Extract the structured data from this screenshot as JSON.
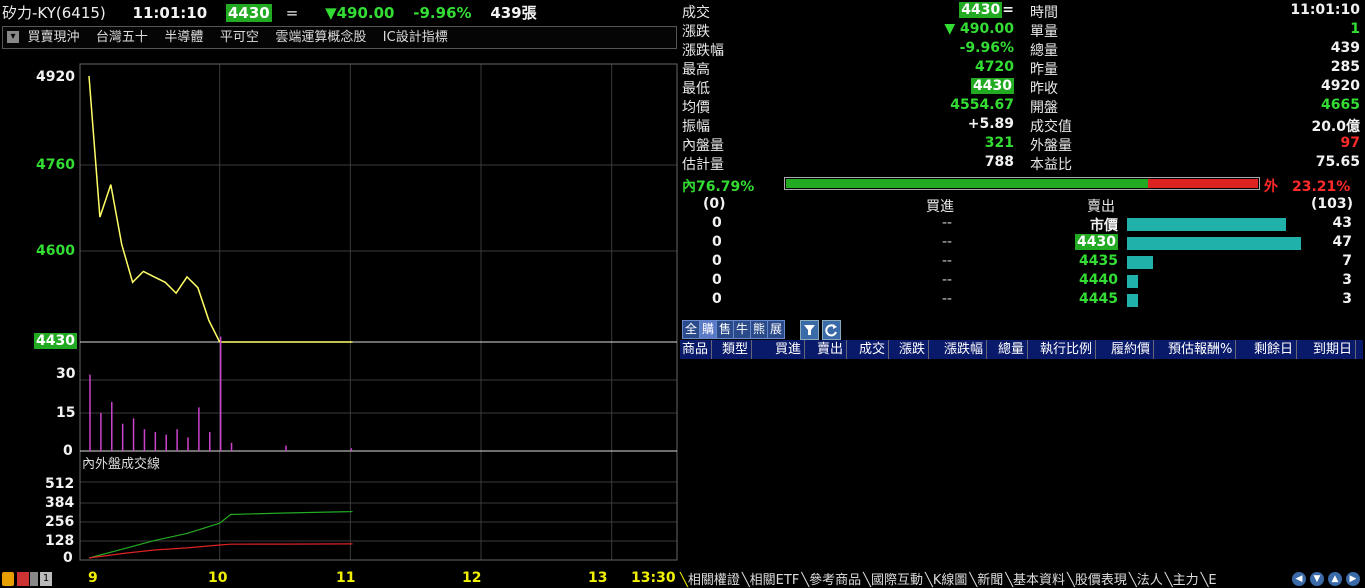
{
  "header": {
    "stock": "矽力-KY(6415)",
    "time": "11:01:10",
    "price": "4430",
    "price_suffix": "=",
    "change": "▼490.00",
    "change_pct": "-9.96%",
    "volume": "439張"
  },
  "tags": [
    "買賣現沖",
    "台灣五十",
    "半導體",
    "平可空",
    "雲端運算概念股",
    "IC設計指標"
  ],
  "chart": {
    "price_ticks": [
      "4920",
      "4760",
      "4600"
    ],
    "current_price_label": "4430",
    "volume_ticks": [
      "30",
      "15",
      "0"
    ],
    "sub_title": "內外盤成交線",
    "sub_ticks": [
      "512",
      "384",
      "256",
      "128",
      "0"
    ],
    "time_ticks": [
      "9",
      "10",
      "11",
      "12",
      "13",
      "13:30"
    ]
  },
  "chart_data": [
    {
      "type": "line",
      "title": "",
      "x": [
        "09:00",
        "09:05",
        "09:10",
        "09:15",
        "09:20",
        "09:25",
        "09:30",
        "09:35",
        "09:40",
        "09:45",
        "09:50",
        "09:55",
        "10:00",
        "10:30",
        "11:00",
        "11:01"
      ],
      "series": [
        {
          "values": [
            4920,
            4660,
            4720,
            4610,
            4540,
            4560,
            4550,
            4540,
            4520,
            4550,
            4530,
            4470,
            4430,
            4430,
            4430,
            4430
          ]
        }
      ],
      "ylim": [
        4430,
        4920
      ]
    },
    {
      "type": "bar",
      "title": "",
      "x": [
        "09:00",
        "09:05",
        "09:10",
        "09:15",
        "09:20",
        "09:25",
        "09:30",
        "09:35",
        "09:40",
        "09:45",
        "09:50",
        "09:55",
        "10:00",
        "10:05",
        "10:30",
        "11:00"
      ],
      "values": [
        28,
        14,
        18,
        10,
        12,
        8,
        7,
        6,
        8,
        5,
        16,
        7,
        42,
        3,
        2,
        1
      ],
      "ylim": [
        0,
        40
      ]
    },
    {
      "type": "line",
      "title": "",
      "x": [
        "09:00",
        "09:15",
        "09:30",
        "09:45",
        "10:00",
        "10:05",
        "10:30",
        "11:00",
        "11:01"
      ],
      "series": [
        {
          "values": [
            0,
            60,
            120,
            170,
            240,
            300,
            310,
            320,
            321
          ]
        },
        {
          "values": [
            0,
            30,
            55,
            70,
            90,
            95,
            96,
            97,
            97
          ]
        }
      ],
      "ylim": [
        0,
        600
      ]
    }
  ],
  "quote": {
    "left_labels": [
      "成交",
      "漲跌",
      "漲跌幅",
      "最高",
      "最低",
      "均價",
      "振幅",
      "內盤量",
      "估計量"
    ],
    "left_values": [
      "4430",
      "▼ 490.00",
      "-9.96%",
      "4720",
      "4430",
      "4554.67",
      "+5.89",
      "321",
      "788"
    ],
    "right_labels": [
      "時間",
      "單量",
      "總量",
      "昨量",
      "昨收",
      "開盤",
      "成交值",
      "外盤量",
      "本益比"
    ],
    "right_values": [
      "11:01:10",
      "1",
      "439",
      "285",
      "4920",
      "4665",
      "20.0億",
      "97",
      "75.65"
    ],
    "last_suffix": "="
  },
  "ratio": {
    "in_label": "內",
    "in_pct": "76.79%",
    "out_label": "外",
    "out_pct": "23.21%",
    "in_fraction": 0.7679
  },
  "orderbook": {
    "buy_total": "(0)",
    "buy_header": "買進",
    "sell_header": "賣出",
    "sell_total": "(103)",
    "rows": [
      {
        "bid_qty": "0",
        "bid_price": "--",
        "ask_price": "市價",
        "ask_qty": "43",
        "ask_level": 43
      },
      {
        "bid_qty": "0",
        "bid_price": "--",
        "ask_price": "4430",
        "ask_qty": "47",
        "ask_level": 47
      },
      {
        "bid_qty": "0",
        "bid_price": "--",
        "ask_price": "4435",
        "ask_qty": "7",
        "ask_level": 7
      },
      {
        "bid_qty": "0",
        "bid_price": "--",
        "ask_price": "4440",
        "ask_qty": "3",
        "ask_level": 3
      },
      {
        "bid_qty": "0",
        "bid_price": "--",
        "ask_price": "4445",
        "ask_qty": "3",
        "ask_level": 3
      }
    ]
  },
  "options_toolbar": [
    "全",
    "購",
    "售",
    "牛",
    "熊",
    "展"
  ],
  "options_columns": [
    "商品",
    "類型",
    "買進",
    "賣出",
    "成交",
    "漲跌",
    "漲跌幅",
    "總量",
    "執行比例",
    "履約價",
    "預估報酬%",
    "剩餘日",
    "到期日"
  ],
  "bottom_tabs": [
    "相關權證",
    "相關ETF",
    "參考商品",
    "國際互動",
    "K線圖",
    "新聞",
    "基本資料",
    "股價表現",
    "法人",
    "主力",
    "E"
  ],
  "colors": {
    "up": "#ff2a2a",
    "down": "#33dd33",
    "line": "#ffff66",
    "volume": "#cc44cc",
    "ask_bar": "#20b2aa"
  }
}
